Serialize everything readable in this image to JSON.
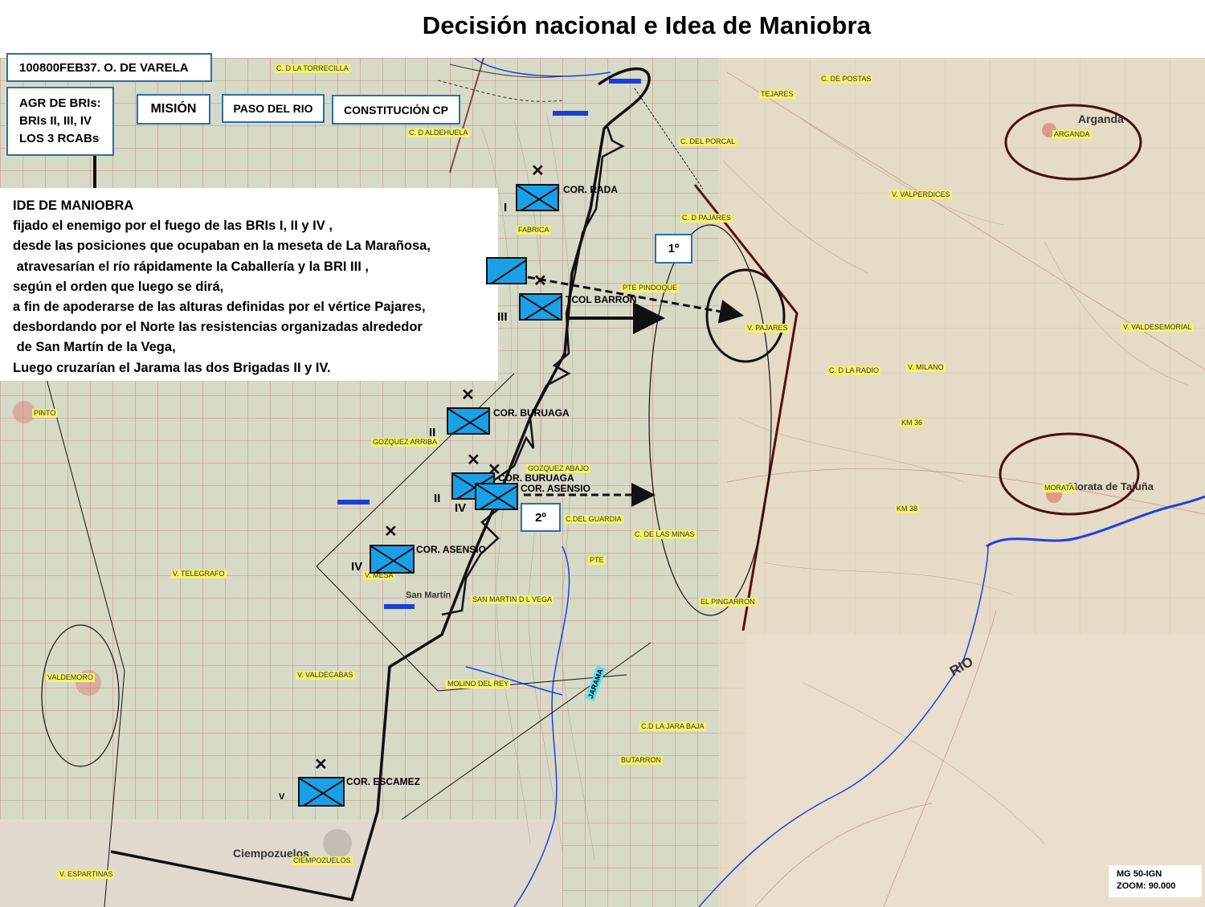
{
  "title": "Decisión nacional e Idea de Maniobra",
  "header": {
    "dtg": "100800FEB37. O. DE VARELA"
  },
  "agr": {
    "line1": "AGR DE BRIs:",
    "line2": "BRIs II, III, IV",
    "line3": "LOS 3 RCABs"
  },
  "buttons": {
    "mision": "MISIÓN",
    "paso": "PASO DEL RIO",
    "constitucion": "CONSTITUCIÓN CP"
  },
  "idea": {
    "heading": "IDE DE MANIOBRA",
    "lines": [
      "fijado el enemigo por el fuego de las BRIs I, II y IV ,",
      "desde las posiciones que ocupaban en la meseta de La Marañosa,",
      " atravesarían el río rápidamente la Caballería y la BRI III ,",
      "según el orden que luego se dirá,",
      "a fin de apoderarse de las alturas definidas por el vértice Pajares,",
      "desbordando por el Norte las resistencias organizadas alrededor",
      " de San Martín de la Vega,",
      "Luego cruzarían el Jarama las dos Brigadas II y IV."
    ]
  },
  "phases": {
    "first": "1º",
    "second": "2º"
  },
  "legend": {
    "line1": "MG 50-IGN",
    "line2": "ZOOM: 90.000"
  },
  "units": {
    "rada": "COR. RADA",
    "barron": "TCOL BARRON",
    "buruaga1": "COR. BURUAGA",
    "buruaga2": "COR. BURUAGA",
    "asensio1": "COR. ASENSIO",
    "asensio2": "COR. ASENSIO",
    "escamez": "COR. ESCAMEZ"
  },
  "numerals": {
    "i": "I",
    "iii": "III",
    "ii_a": "II",
    "ii_b": "II",
    "iv_a": "IV",
    "iv_b": "IV",
    "v": "V"
  },
  "places": {
    "torrecilla": "C. D LA TORRECILLA",
    "aldehuela": "C. D ALDEHUELA",
    "porcal": "C. DEL PORCAL",
    "pajares_c": "C. D PAJARES",
    "fabrica": "FABRICA",
    "pindoque": "PTE PINDOQUE",
    "pajares_v": "V. PAJARES",
    "postas": "C. DE POSTAS",
    "tejares": "TEJARES",
    "arganda_tag": "ARGANDA",
    "valperdices": "V. VALPERDICES",
    "valdesemorial": "V. VALDESEMORIAL",
    "laradio": "C. D LA RADIO",
    "milano": "V. MILANO",
    "km36": "KM 36",
    "km38": "KM 38",
    "morata_tag": "MORATA",
    "pinto": "PINTO",
    "gozquez_arriba": "GOZQUEZ ARRIBA",
    "gozquez_abajo": "GOZQUEZ ABAJO",
    "guardia": "C.DEL GUARDIA",
    "minas": "C. DE LAS MINAS",
    "pingarron": "EL PINGARRON",
    "pte": "PTE",
    "telegrafo": "V. TELEGRAFO",
    "mesa": "V. MESA",
    "sanmartin": "SAN MARTIN D L VEGA",
    "valdemoro": "VALDEMORO",
    "valdecabas": "V. VALDECABAS",
    "molino": "MOLINO DEL REY",
    "jarabaja": "C.D LA JARA BAJA",
    "butarron": "BUTARRON",
    "ciempozuelos_tag": "CIEMPOZUELOS",
    "espartinas": "V. ESPARTINAS"
  },
  "map_text": {
    "arganda": "Arganda",
    "morata": "Morata de Tajuña",
    "ciempozuelos": "Ciempozuelos",
    "rio": "RIO",
    "jarama": "JARAMA",
    "sanmartin": "San Martín"
  },
  "colors": {
    "frame": "#2a6fa8",
    "unit_fill": "#1aa0e6",
    "river": "#1f3fe8",
    "enemy_line": "#5a0f0f",
    "place_tag": "#f5f26a",
    "map_left": "#d9dcc7",
    "map_right": "#e6dcc6"
  }
}
